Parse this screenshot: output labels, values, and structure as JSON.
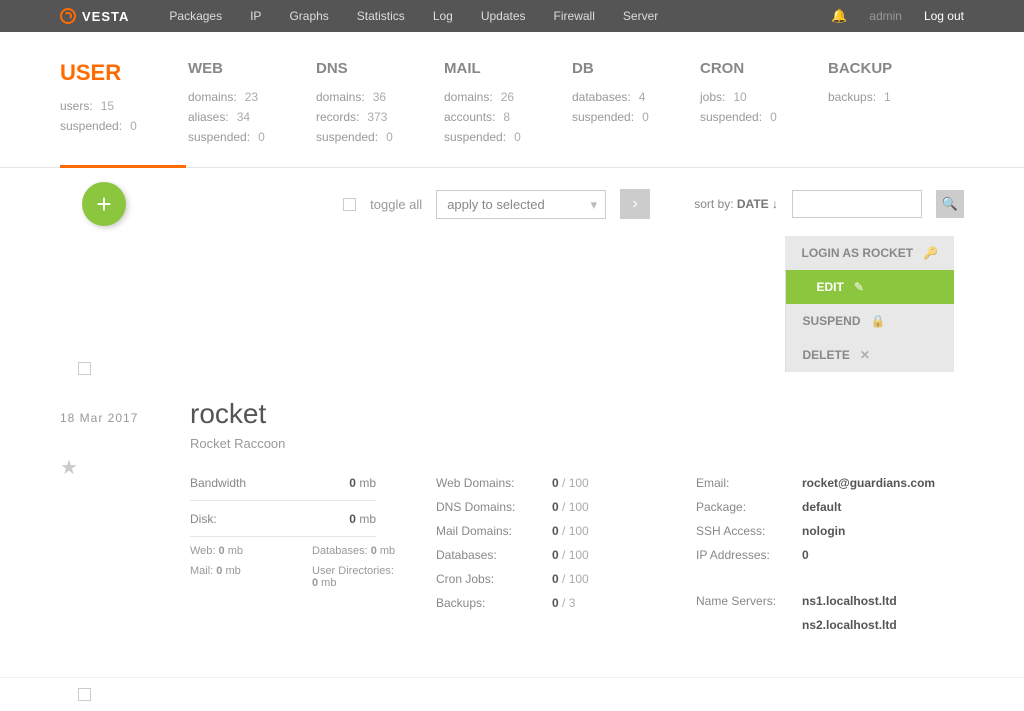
{
  "brand": "VESTA",
  "nav": [
    "Packages",
    "IP",
    "Graphs",
    "Statistics",
    "Log",
    "Updates",
    "Firewall",
    "Server"
  ],
  "user_label": "admin",
  "logout": "Log out",
  "cats": [
    {
      "title": "USER",
      "active": true,
      "stats": [
        [
          "users:",
          "15"
        ],
        [
          "suspended:",
          "0"
        ]
      ]
    },
    {
      "title": "WEB",
      "stats": [
        [
          "domains:",
          "23"
        ],
        [
          "aliases:",
          "34"
        ],
        [
          "suspended:",
          "0"
        ]
      ]
    },
    {
      "title": "DNS",
      "stats": [
        [
          "domains:",
          "36"
        ],
        [
          "records:",
          "373"
        ],
        [
          "suspended:",
          "0"
        ]
      ]
    },
    {
      "title": "MAIL",
      "stats": [
        [
          "domains:",
          "26"
        ],
        [
          "accounts:",
          "8"
        ],
        [
          "suspended:",
          "0"
        ]
      ]
    },
    {
      "title": "DB",
      "stats": [
        [
          "databases:",
          "4"
        ],
        [
          "suspended:",
          "0"
        ]
      ]
    },
    {
      "title": "CRON",
      "stats": [
        [
          "jobs:",
          "10"
        ],
        [
          "suspended:",
          "0"
        ]
      ]
    },
    {
      "title": "BACKUP",
      "stats": [
        [
          "backups:",
          "1"
        ]
      ]
    }
  ],
  "toolbar": {
    "toggle_all": "toggle all",
    "apply": "apply to selected",
    "sort_label": "sort by:",
    "sort_value": "DATE ↓"
  },
  "actions": {
    "login_as": "LOGIN AS ROCKET",
    "edit": "EDIT",
    "suspend": "SUSPEND",
    "delete": "DELETE"
  },
  "entry": {
    "date": "18 Mar 2017",
    "name": "rocket",
    "fullname": "Rocket Raccoon",
    "bandwidth_label": "Bandwidth",
    "bandwidth_val": "0",
    "bandwidth_unit": "mb",
    "disk_label": "Disk:",
    "disk_val": "0",
    "disk_unit": "mb",
    "small": {
      "web": "Web: 0 mb",
      "databases": "Databases: 0 mb",
      "mail": "Mail: 0 mb",
      "userdirs": "User Directories: 0 mb"
    },
    "mid": [
      [
        "Web Domains:",
        "0",
        " / 100"
      ],
      [
        "DNS Domains:",
        "0",
        " / 100"
      ],
      [
        "Mail Domains:",
        "0",
        " / 100"
      ],
      [
        "Databases:",
        "0",
        " / 100"
      ],
      [
        "Cron Jobs:",
        "0",
        " / 100"
      ],
      [
        "Backups:",
        "0",
        " / 3"
      ]
    ],
    "right": {
      "email_k": "Email:",
      "email_v": "rocket@guardians.com",
      "package_k": "Package:",
      "package_v": "default",
      "ssh_k": "SSH Access:",
      "ssh_v": "nologin",
      "ip_k": "IP Addresses:",
      "ip_v": "0",
      "ns_k": "Name Servers:",
      "ns1": "ns1.localhost.ltd",
      "ns2": "ns2.localhost.ltd"
    }
  }
}
